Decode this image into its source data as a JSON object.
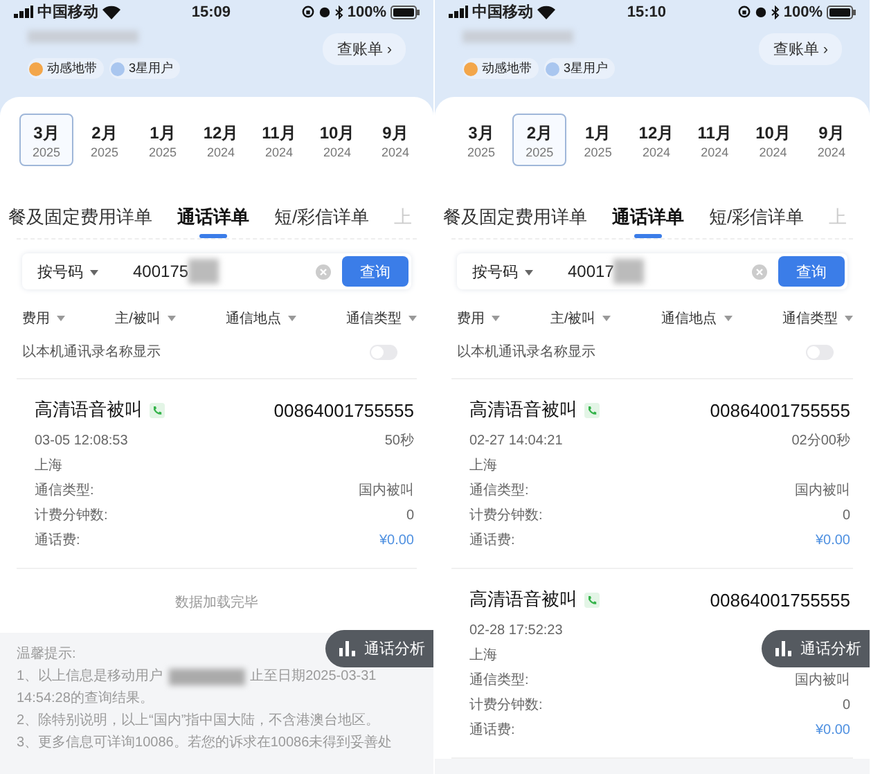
{
  "screens": [
    {
      "status": {
        "carrier": "中国移动",
        "time": "15:09",
        "battery": "100%"
      },
      "header": {
        "badges": [
          {
            "label": "动感地带",
            "kind": "mzone"
          },
          {
            "label": "3星用户",
            "kind": "star"
          }
        ],
        "bill_button": "查账单 ›"
      },
      "months": [
        {
          "month": "3月",
          "year": "2025",
          "selected": true
        },
        {
          "month": "2月",
          "year": "2025",
          "selected": false
        },
        {
          "month": "1月",
          "year": "2025",
          "selected": false
        },
        {
          "month": "12月",
          "year": "2024",
          "selected": false
        },
        {
          "month": "11月",
          "year": "2024",
          "selected": false
        },
        {
          "month": "10月",
          "year": "2024",
          "selected": false
        },
        {
          "month": "9月",
          "year": "2024",
          "selected": false
        }
      ],
      "tabs": [
        {
          "label": "餐及固定费用详单",
          "selected": false
        },
        {
          "label": "通话详单",
          "selected": true
        },
        {
          "label": "短/彩信详单",
          "selected": false
        },
        {
          "label": "上",
          "selected": false
        }
      ],
      "search": {
        "mode": "按号码",
        "value": "400175",
        "button": "查询"
      },
      "filters": [
        "费用",
        "主/被叫",
        "通信地点",
        "通信类型"
      ],
      "contact_toggle": {
        "label": "以本机通讯录名称显示",
        "on": false
      },
      "records": [
        {
          "title": "高清语音被叫",
          "number": "00864001755555",
          "time": "03-05 12:08:53",
          "duration": "50秒",
          "place": "上海",
          "fields": [
            {
              "label": "通信类型:",
              "value": "国内被叫",
              "kind": "plain"
            },
            {
              "label": "计费分钟数:",
              "value": "0",
              "kind": "plain"
            },
            {
              "label": "通话费:",
              "value": "¥0.00",
              "kind": "fee"
            }
          ]
        }
      ],
      "load_complete": "数据加载完毕",
      "analysis_button": "通话分析",
      "tips": {
        "title": "温馨提示:",
        "lines": [
          {
            "before": "1、以上信息是移动用户",
            "after": "止至日期2025-03-31"
          },
          {
            "before": "14:54:28的查询结果。"
          },
          {
            "before": "2、除特别说明，以上“国内”指中国大陆，不含港澳台地区。"
          },
          {
            "before": "3、更多信息可详询10086。若您的诉求在10086未得到妥善处"
          }
        ]
      }
    },
    {
      "status": {
        "carrier": "中国移动",
        "time": "15:10",
        "battery": "100%"
      },
      "header": {
        "badges": [
          {
            "label": "动感地带",
            "kind": "mzone"
          },
          {
            "label": "3星用户",
            "kind": "star"
          }
        ],
        "bill_button": "查账单 ›"
      },
      "months": [
        {
          "month": "3月",
          "year": "2025",
          "selected": false
        },
        {
          "month": "2月",
          "year": "2025",
          "selected": true
        },
        {
          "month": "1月",
          "year": "2025",
          "selected": false
        },
        {
          "month": "12月",
          "year": "2024",
          "selected": false
        },
        {
          "month": "11月",
          "year": "2024",
          "selected": false
        },
        {
          "month": "10月",
          "year": "2024",
          "selected": false
        },
        {
          "month": "9月",
          "year": "2024",
          "selected": false
        }
      ],
      "tabs": [
        {
          "label": "餐及固定费用详单",
          "selected": false
        },
        {
          "label": "通话详单",
          "selected": true
        },
        {
          "label": "短/彩信详单",
          "selected": false
        },
        {
          "label": "上",
          "selected": false
        }
      ],
      "search": {
        "mode": "按号码",
        "value": "40017",
        "button": "查询"
      },
      "filters": [
        "费用",
        "主/被叫",
        "通信地点",
        "通信类型"
      ],
      "contact_toggle": {
        "label": "以本机通讯录名称显示",
        "on": false
      },
      "records": [
        {
          "title": "高清语音被叫",
          "number": "00864001755555",
          "time": "02-27 14:04:21",
          "duration": "02分00秒",
          "place": "上海",
          "fields": [
            {
              "label": "通信类型:",
              "value": "国内被叫",
              "kind": "plain"
            },
            {
              "label": "计费分钟数:",
              "value": "0",
              "kind": "plain"
            },
            {
              "label": "通话费:",
              "value": "¥0.00",
              "kind": "fee"
            }
          ]
        },
        {
          "title": "高清语音被叫",
          "number": "00864001755555",
          "time": "02-28 17:52:23",
          "place": "上海",
          "fields": [
            {
              "label": "通信类型:",
              "value": "国内被叫",
              "kind": "plain"
            },
            {
              "label": "计费分钟数:",
              "value": "0",
              "kind": "plain"
            },
            {
              "label": "通话费:",
              "value": "¥0.00",
              "kind": "fee"
            }
          ]
        }
      ],
      "analysis_button": "通话分析"
    }
  ]
}
